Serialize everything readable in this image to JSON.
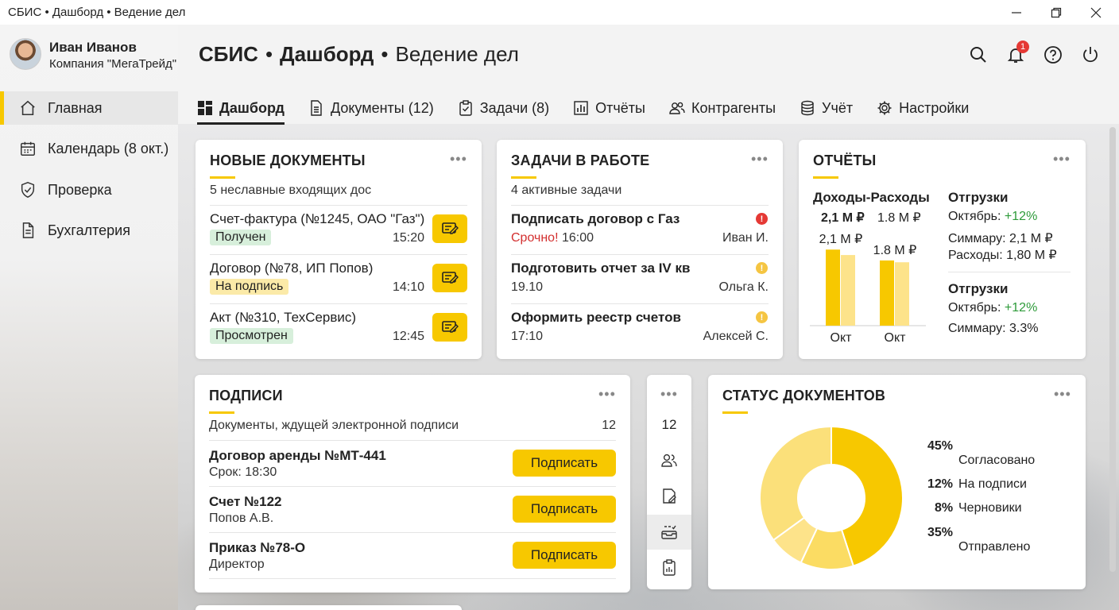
{
  "window": {
    "title": "СБИС • Дашборд • Ведение дел"
  },
  "user": {
    "name": "Иван Иванов",
    "company": "Компания \"МегаТрейд\""
  },
  "header": {
    "brand": "СБИС",
    "sep1": "•",
    "section": "Дашборд",
    "sep2": "•",
    "subsection": "Ведение дел",
    "notifications": "1"
  },
  "sidebar": {
    "items": [
      {
        "label": "Главная",
        "icon": "home-icon",
        "active": true
      },
      {
        "label": "Календарь (8 окт.)",
        "icon": "calendar-icon"
      },
      {
        "label": "Проверка",
        "icon": "shield-icon"
      },
      {
        "label": "Бухгалтерия",
        "icon": "document-icon"
      }
    ]
  },
  "tabs": [
    {
      "label": "Дашборд",
      "icon": "grid-icon",
      "active": true
    },
    {
      "label": "Документы (12)",
      "icon": "document-icon"
    },
    {
      "label": "Задачи (8)",
      "icon": "clipboard-check-icon"
    },
    {
      "label": "Отчёты",
      "icon": "bar-chart-icon"
    },
    {
      "label": "Контрагенты",
      "icon": "users-icon"
    },
    {
      "label": "Учёт",
      "icon": "database-icon"
    },
    {
      "label": "Настройки",
      "icon": "gear-icon"
    }
  ],
  "new_docs": {
    "title": "НОВЫЕ ДОКУМЕНТЫ",
    "subtitle": "5 неславные входящих дос",
    "items": [
      {
        "name": "Счет-фактура (№1245, ОАО \"Газ\")",
        "status": "Получен",
        "time": "15:20"
      },
      {
        "name": "Договор (№78, ИП Попов)",
        "status": "На подпись",
        "time": "14:10"
      },
      {
        "name": "Акт (№310, ТехСервис)",
        "status": "Просмотрен",
        "time": "12:45"
      }
    ]
  },
  "tasks": {
    "title": "ЗАДАЧИ В РАБОТЕ",
    "subtitle": "4 активные задачи",
    "items": [
      {
        "name": "Подписать договор с Газ",
        "urgent": "Срочно!",
        "time": "16:00",
        "assignee": "Иван И.",
        "priority_color": "#e53935"
      },
      {
        "name": "Подготовить отчет за IV кв",
        "time": "19.10",
        "assignee": "Ольга К.",
        "priority_color": "#f5c542"
      },
      {
        "name": "Оформить реестр счетов",
        "time": "17:10",
        "assignee": "Алексей С.",
        "priority_color": "#f5c542"
      }
    ]
  },
  "reports": {
    "title": "ОТЧЁТЫ",
    "chart_heading": "Доходы-Расходы",
    "value_a": "2,1 М ₽",
    "value_b": "1.8 М ₽",
    "bar_label_a": "2,1 М ₽",
    "bar_label_b": "1.8 М ₽",
    "shipments1": {
      "title": "Отгрузки",
      "month": "Октябрь:",
      "growth": "+12%",
      "summary": "Симмару: 2,1 М ₽",
      "expenses": "Расходы: 1,80 М ₽"
    },
    "shipments2": {
      "title": "Отгрузки",
      "month": "Октябрь:",
      "growth": "+12%",
      "summary": "Симмару: 3.3%"
    }
  },
  "chart_data": {
    "type": "bar",
    "categories": [
      "Окт",
      "Окт"
    ],
    "series": [
      {
        "values": [
          2.1,
          1.8
        ]
      },
      {
        "values": [
          1.95,
          1.75
        ]
      }
    ],
    "ylim": [
      0,
      2.5
    ],
    "colors": [
      "#f7c800",
      "#fde38a"
    ]
  },
  "signatures": {
    "title": "ПОДПИСИ",
    "subtitle": "Документы, ждущей электронной подписи",
    "count": "12",
    "button_label": "Подписать",
    "items": [
      {
        "name": "Договор аренды №МТ-441",
        "detail": "Срок: 18:30"
      },
      {
        "name": "Счет №122",
        "detail": "Попов А.В."
      },
      {
        "name": "Приказ №78-О",
        "detail": "Директор"
      }
    ]
  },
  "mini": {
    "count": "12"
  },
  "status": {
    "title": "СТАТУС ДОКУМЕНТОВ",
    "items": [
      {
        "pct": "45%",
        "label": "Согласовано",
        "value": 45,
        "color": "#f7c800"
      },
      {
        "pct": "12%",
        "label": "На подписи",
        "value": 12,
        "color": "#fbdc63"
      },
      {
        "pct": "8%",
        "label": "Черновики",
        "value": 8,
        "color": "#fde38a"
      },
      {
        "pct": "35%",
        "label": "Отправлено",
        "value": 35,
        "color": "#fbe07a"
      }
    ]
  },
  "dots": "•••"
}
